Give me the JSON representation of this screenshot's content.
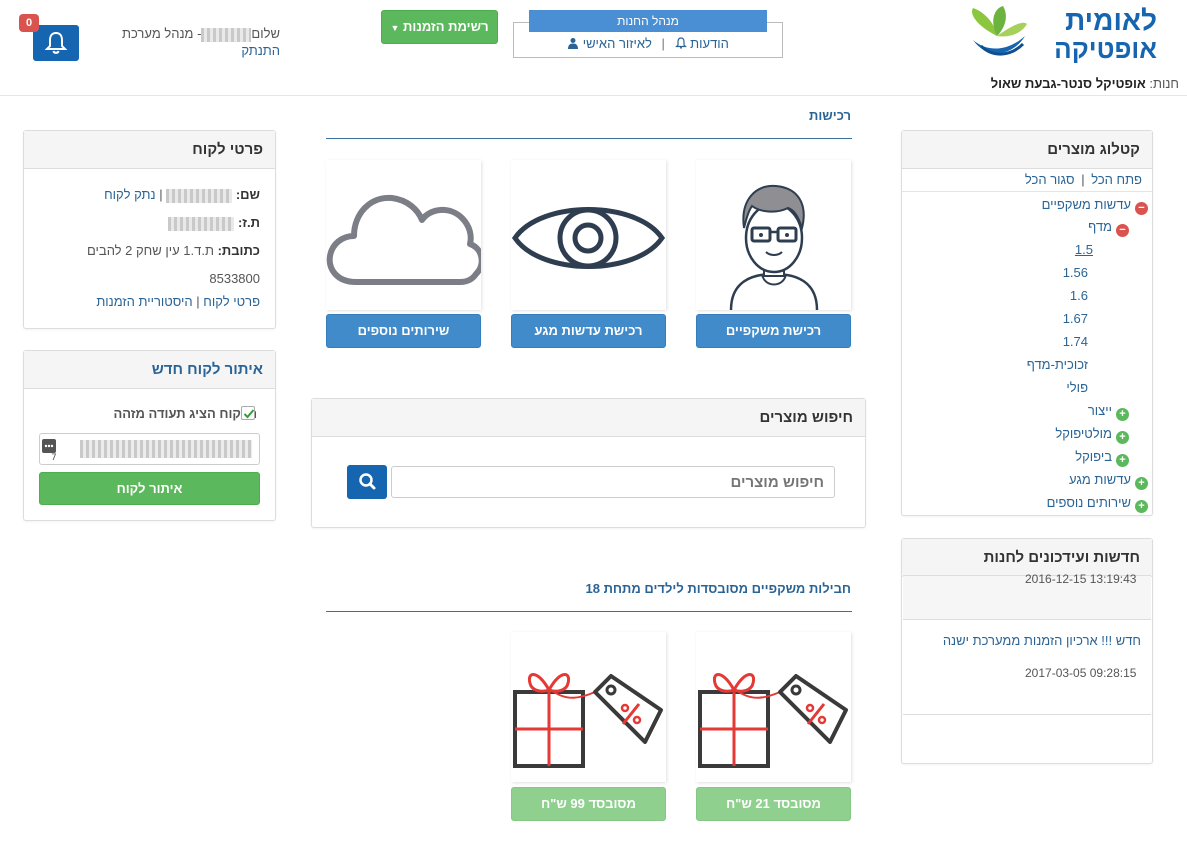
{
  "header": {
    "brand_line1": "לאומית",
    "brand_line2": "אופטיקה",
    "store_label": "חנות:",
    "store_name": "אופטיקל סנטר-גבעת שאול",
    "manager_title": "מנהל החנות",
    "personal_area": "לאיזור האישי",
    "messages": "הודעות",
    "separator": "|",
    "order_list": "רשימת הזמנות",
    "greeting_prefix": "שלום",
    "greeting_suffix": "- מנהל מערכת",
    "logout": "התנתק",
    "notifications_count": "0"
  },
  "catalog": {
    "title": "קטלוג מוצרים",
    "open_all": "פתח הכל",
    "close_all": "סגור הכל",
    "sep": "|",
    "items": [
      {
        "label": "עדשות משקפיים",
        "state": "minus"
      },
      {
        "label": "מדף",
        "state": "minus"
      },
      {
        "label": "1.5"
      },
      {
        "label": "1.56"
      },
      {
        "label": "1.6"
      },
      {
        "label": "1.67"
      },
      {
        "label": "1.74"
      },
      {
        "label": "זכוכית-מדף"
      },
      {
        "label": "פולי"
      },
      {
        "label": "ייצור",
        "state": "plus"
      },
      {
        "label": "מולטיפוקל",
        "state": "plus"
      },
      {
        "label": "ביפוקל",
        "state": "plus"
      },
      {
        "label": "עדשות מגע",
        "state": "plus"
      },
      {
        "label": "שירותים נוספים",
        "state": "plus"
      }
    ]
  },
  "news": {
    "title": "חדשות ועידכונים לחנות",
    "item1_date": "2016-12-15 13:19:43",
    "item2_link": "חדש !!! ארכיון הזמנות ממערכת ישנה",
    "item2_date": "2017-03-05 09:28:15"
  },
  "purchases": {
    "title": "רכישות",
    "buttons": [
      "רכישת משקפיים",
      "רכישת עדשות מגע",
      "שירותים נוספים"
    ]
  },
  "search": {
    "title": "חיפוש מוצרים",
    "placeholder": "חיפוש מוצרים"
  },
  "packages": {
    "title": "חבילות משקפיים מסובסדות לילדים מתחת 18",
    "buttons": [
      "מסובסד 21 ש\"ח",
      "מסובסד 99 ש\"ח"
    ]
  },
  "customer": {
    "title": "פרטי לקוח",
    "name_label": "שם:",
    "disconnect": "נתק לקוח",
    "id_label": "ת.ז:",
    "address_label": "כתובת:",
    "address_value": "ת.ד.1 עין שחק 2 להבים",
    "zip": "8533800",
    "details_link": "פרטי לקוח",
    "history_link": "היסטוריית הזמנות",
    "sep": "|"
  },
  "locate": {
    "title": "איתור לקוח חדש",
    "checkbox_label": "הלקוח הציג תעודה מזהה",
    "button": "איתור לקוח"
  },
  "colors": {
    "primary": "#428bca",
    "dark_blue": "#1565b0",
    "green": "#5cb85c",
    "red": "#d9534f"
  }
}
